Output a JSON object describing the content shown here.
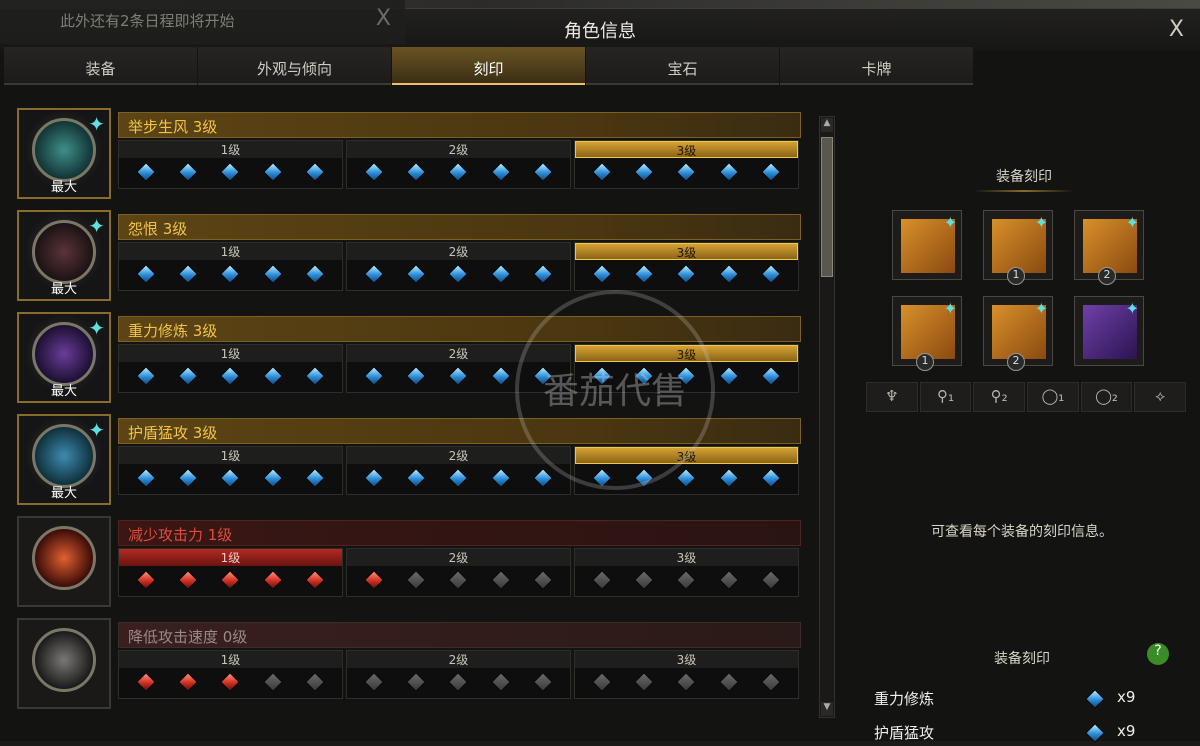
{
  "notice": {
    "text": "此外还有2条日程即将开始",
    "close": "X"
  },
  "window": {
    "title": "角色信息",
    "close": "X"
  },
  "tabs": [
    {
      "label": "装备"
    },
    {
      "label": "外观与倾向"
    },
    {
      "label": "刻印"
    },
    {
      "label": "宝石"
    },
    {
      "label": "卡牌"
    }
  ],
  "active_tab": "刻印",
  "engravings": [
    {
      "name": "举步生风 3级",
      "badge": "最大",
      "style": "gold",
      "levels": [
        "1级",
        "2级",
        "3级"
      ],
      "active_level": 3,
      "gems": [
        "b",
        "b",
        "b",
        "b",
        "b",
        "b",
        "b",
        "b",
        "b",
        "b",
        "b",
        "b",
        "b",
        "b",
        "b"
      ]
    },
    {
      "name": "怨恨 3级",
      "badge": "最大",
      "style": "gold",
      "levels": [
        "1级",
        "2级",
        "3级"
      ],
      "active_level": 3,
      "gems": [
        "b",
        "b",
        "b",
        "b",
        "b",
        "b",
        "b",
        "b",
        "b",
        "b",
        "b",
        "b",
        "b",
        "b",
        "b"
      ]
    },
    {
      "name": "重力修炼 3级",
      "badge": "最大",
      "style": "gold",
      "levels": [
        "1级",
        "2级",
        "3级"
      ],
      "active_level": 3,
      "gems": [
        "b",
        "b",
        "b",
        "b",
        "b",
        "b",
        "b",
        "b",
        "b",
        "b",
        "b",
        "b",
        "b",
        "b",
        "b"
      ]
    },
    {
      "name": "护盾猛攻 3级",
      "badge": "最大",
      "style": "gold",
      "levels": [
        "1级",
        "2级",
        "3级"
      ],
      "active_level": 3,
      "gems": [
        "b",
        "b",
        "b",
        "b",
        "b",
        "b",
        "b",
        "b",
        "b",
        "b",
        "b",
        "b",
        "b",
        "b",
        "b"
      ]
    },
    {
      "name": "减少攻击力 1级",
      "badge": "",
      "style": "red",
      "levels": [
        "1级",
        "2级",
        "3级"
      ],
      "active_level": 1,
      "gems": [
        "r",
        "r",
        "r",
        "r",
        "r",
        "r",
        "g",
        "g",
        "g",
        "g",
        "g",
        "g",
        "g",
        "g",
        "g"
      ]
    },
    {
      "name": "降低攻击速度 0级",
      "badge": "",
      "style": "grey",
      "levels": [
        "1级",
        "2级",
        "3级"
      ],
      "active_level": 0,
      "gems": [
        "r",
        "r",
        "r",
        "g",
        "g",
        "g",
        "g",
        "g",
        "g",
        "g",
        "g",
        "g",
        "g",
        "g",
        "g"
      ]
    }
  ],
  "side": {
    "equip_title": "装备刻印",
    "equip_items": [
      {
        "kind": "necklace",
        "num": ""
      },
      {
        "kind": "earring",
        "num": "1"
      },
      {
        "kind": "earring",
        "num": "2"
      },
      {
        "kind": "ring",
        "num": "1"
      },
      {
        "kind": "ring",
        "num": "2"
      },
      {
        "kind": "stone",
        "num": ""
      }
    ],
    "filters": [
      "necklace-filter",
      "earring-1-filter",
      "earring-2-filter",
      "ring-1-filter",
      "ring-2-filter",
      "stone-filter"
    ],
    "hint": "可查看每个装备的刻印信息。",
    "summary_title": "装备刻印",
    "summary": [
      {
        "name": "重力修炼",
        "count": "x9"
      },
      {
        "name": "护盾猛攻",
        "count": "x9"
      }
    ]
  },
  "watermark": "番茄代售",
  "colors": {
    "gold": "#f0c44c",
    "red": "#e04c40",
    "accent": "#e8c36a"
  }
}
